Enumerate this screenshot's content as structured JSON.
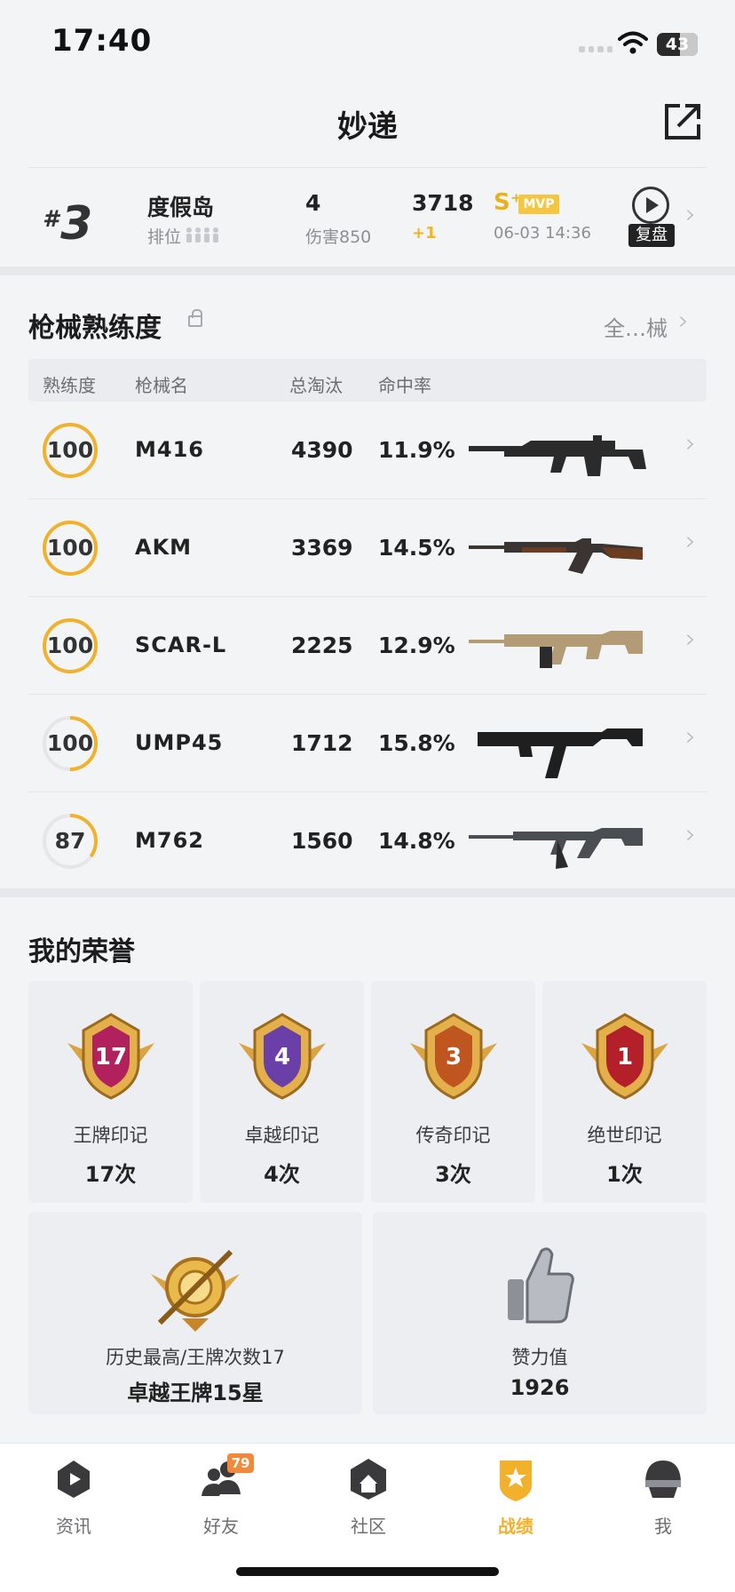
{
  "status": {
    "time": "17:40",
    "battery": "43"
  },
  "header": {
    "title": "妙递"
  },
  "recent_match": {
    "rank_hash": "#",
    "rank": "3",
    "map": "度假岛",
    "rank_label": "排位",
    "kills": "4",
    "damage": "伤害850",
    "score": "3718",
    "score_delta": "+1",
    "grade": "S⁺",
    "mvp": "MVP",
    "datetime": "06-03 14:36",
    "replay_label": "复盘"
  },
  "weapons": {
    "title": "枪械熟练度",
    "all_link": "全…械",
    "headers": {
      "proficiency": "熟练度",
      "name": "枪械名",
      "kills": "总淘汰",
      "accuracy": "命中率"
    },
    "rows": [
      {
        "proficiency": "100",
        "level": 1.0,
        "name": "M416",
        "kills": "4390",
        "accuracy": "11.9%",
        "gun": "m416-rifle-icon"
      },
      {
        "proficiency": "100",
        "level": 1.0,
        "name": "AKM",
        "kills": "3369",
        "accuracy": "14.5%",
        "gun": "akm-rifle-icon"
      },
      {
        "proficiency": "100",
        "level": 1.0,
        "name": "SCAR-L",
        "kills": "2225",
        "accuracy": "12.9%",
        "gun": "scarl-rifle-icon"
      },
      {
        "proficiency": "100",
        "level": 0.5,
        "name": "UMP45",
        "kills": "1712",
        "accuracy": "15.8%",
        "gun": "ump45-smg-icon"
      },
      {
        "proficiency": "87",
        "level": 0.35,
        "name": "M762",
        "kills": "1560",
        "accuracy": "14.8%",
        "gun": "m762-rifle-icon"
      }
    ]
  },
  "honors": {
    "title": "我的荣誉",
    "items": [
      {
        "badge_num": "17",
        "label": "王牌印记",
        "count": "17次",
        "color": "#b0215e"
      },
      {
        "badge_num": "4",
        "label": "卓越印记",
        "count": "4次",
        "color": "#6a3fa8"
      },
      {
        "badge_num": "3",
        "label": "传奇印记",
        "count": "3次",
        "color": "#c0561f"
      },
      {
        "badge_num": "1",
        "label": "绝世印记",
        "count": "1次",
        "color": "#b3202a"
      }
    ],
    "best": {
      "label": "历史最高/王牌次数17",
      "value": "卓越王牌15星"
    },
    "likes": {
      "label": "赞力值",
      "value": "1926"
    }
  },
  "tabs": [
    {
      "label": "资讯",
      "icon": "news-icon"
    },
    {
      "label": "好友",
      "icon": "friends-icon",
      "badge": "79"
    },
    {
      "label": "社区",
      "icon": "community-icon"
    },
    {
      "label": "战绩",
      "icon": "record-icon",
      "active": true
    },
    {
      "label": "我",
      "icon": "profile-helmet-icon"
    }
  ],
  "colors": {
    "accent": "#f1b12a",
    "ring_track": "#e6e6e8"
  }
}
